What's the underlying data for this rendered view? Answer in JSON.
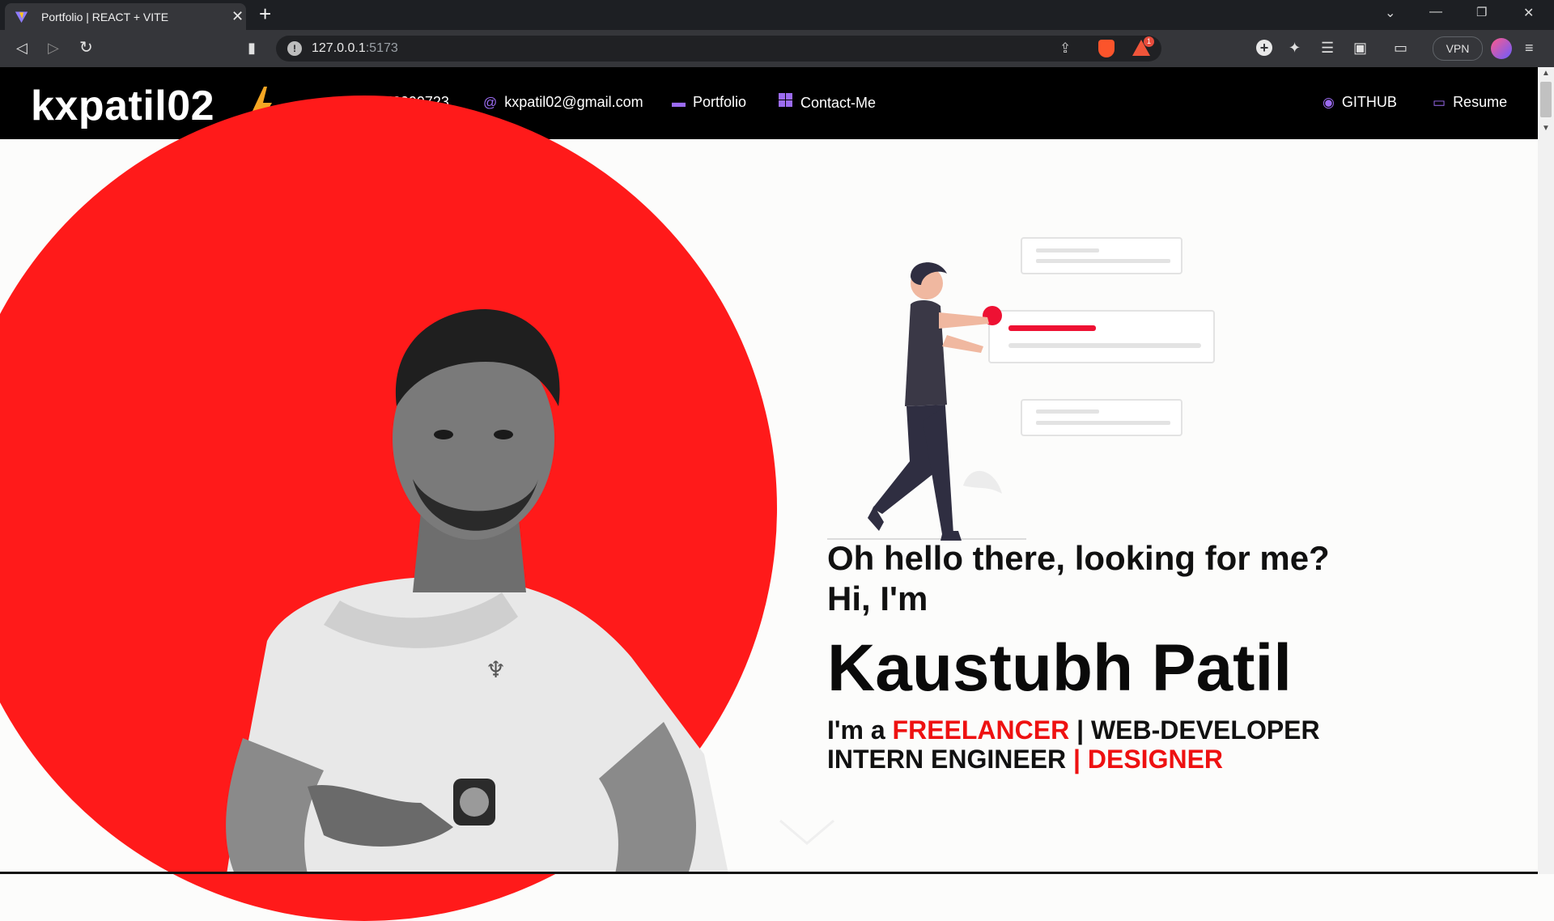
{
  "browser": {
    "tab_title": "Portfolio | REACT + VITE",
    "tab_close": "✕",
    "new_tab": "+",
    "address_host": "127.0.0.1",
    "address_port": ":5173",
    "vpn_label": "VPN",
    "nav_icons": [
      "back-icon",
      "forward-icon",
      "reload-icon",
      "bookmark-icon"
    ],
    "toolbar_icons": [
      "add-icon",
      "extensions-icon",
      "playlist-icon",
      "sidebar-icon",
      "wallet-icon",
      "menu-icon"
    ]
  },
  "navbar": {
    "brand": "kxpatil02",
    "items": [
      {
        "label": "+91 8552099723",
        "icon": "user-icon"
      },
      {
        "label": "kxpatil02@gmail.com",
        "icon": "at-icon"
      },
      {
        "label": "Portfolio",
        "icon": "chat-icon"
      },
      {
        "label": "Contact-Me",
        "icon": "grid-icon"
      }
    ],
    "github": "GITHUB",
    "resume": "Resume"
  },
  "hero": {
    "greeting": "Oh hello there, looking for me?",
    "hi": "Hi, I'm",
    "name": "Kaustubh Patil",
    "roles_prefix": "I'm a",
    "role_1": "FREELANCER",
    "role_2": "| WEB-DEVELOPER",
    "role_3": "INTERN ENGINEER",
    "role_4": "| DESIGNER"
  },
  "colors": {
    "accent_red": "#ee1111",
    "nav_icon_purple": "#9b6bf0",
    "bolt_orange": "#f5a623"
  }
}
